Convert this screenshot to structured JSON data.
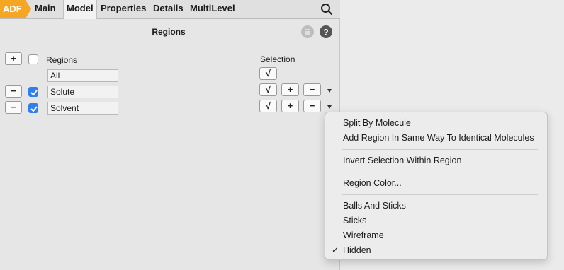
{
  "tabs": {
    "adf": "ADF",
    "items": [
      "Main",
      "Model",
      "Properties",
      "Details",
      "MultiLevel"
    ],
    "active": "Model"
  },
  "panel": {
    "title": "Regions",
    "regions_header": "Regions",
    "selection_header": "Selection",
    "plus": "+",
    "minus": "−",
    "check": "√",
    "rows": [
      {
        "name": "All",
        "checked": false
      },
      {
        "name": "Solute",
        "checked": true
      },
      {
        "name": "Solvent",
        "checked": true
      }
    ]
  },
  "menu": {
    "items": [
      "Split By Molecule",
      "Add Region In Same Way To Identical Molecules",
      "Invert Selection Within Region",
      "Region Color...",
      "Balls And Sticks",
      "Sticks",
      "Wireframe",
      "Hidden"
    ],
    "checked_item": "Hidden",
    "checkmark": "✓"
  },
  "colors": {
    "accent_orange": "#f5a623",
    "checkbox_blue": "#2f7ff0"
  }
}
